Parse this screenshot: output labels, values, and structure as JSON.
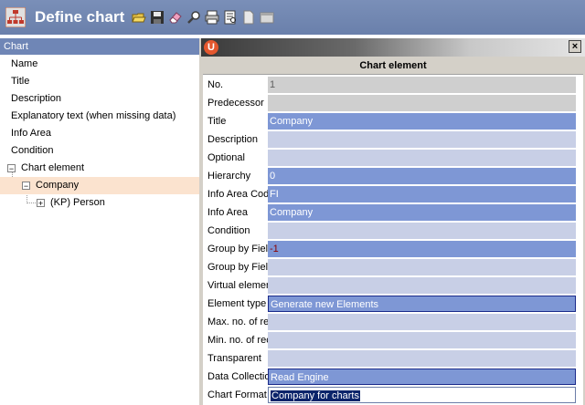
{
  "app": {
    "title": "Define chart"
  },
  "toolbar": [
    "open-folder-icon",
    "save-icon",
    "eraser-icon",
    "zoom-icon",
    "print-icon",
    "print-preview-icon",
    "document-icon",
    "window-icon"
  ],
  "tree": {
    "header": "Chart",
    "items": [
      "Name",
      "Title",
      "Description",
      "Explanatory text (when missing data)",
      "Info Area",
      "Condition"
    ],
    "chart_element": "Chart element",
    "company": "Company",
    "person": "(KP) Person"
  },
  "dialog": {
    "header": "Chart element",
    "fields": [
      {
        "label": "No.",
        "value": "1"
      },
      {
        "label": "Predecessor",
        "value": ""
      },
      {
        "label": "Title",
        "value": "Company"
      },
      {
        "label": "Description",
        "value": ""
      },
      {
        "label": "Optional",
        "value": ""
      },
      {
        "label": "Hierarchy",
        "value": "0"
      },
      {
        "label": "Info Area Code",
        "value": "FI"
      },
      {
        "label": "Info Area",
        "value": "Company"
      },
      {
        "label": "Condition",
        "value": ""
      },
      {
        "label": "Group by Field",
        "value": "-1"
      },
      {
        "label": "Group by Field",
        "value": ""
      },
      {
        "label": "Virtual element",
        "value": ""
      },
      {
        "label": "Element type",
        "value": "Generate new Elements"
      },
      {
        "label": "Max. no. of records",
        "value": ""
      },
      {
        "label": "Min. no. of records",
        "value": ""
      },
      {
        "label": "Transparent",
        "value": ""
      },
      {
        "label": "Data Collection",
        "value": "Read Engine"
      },
      {
        "label": "Chart Format",
        "value": "Company for charts"
      }
    ]
  }
}
